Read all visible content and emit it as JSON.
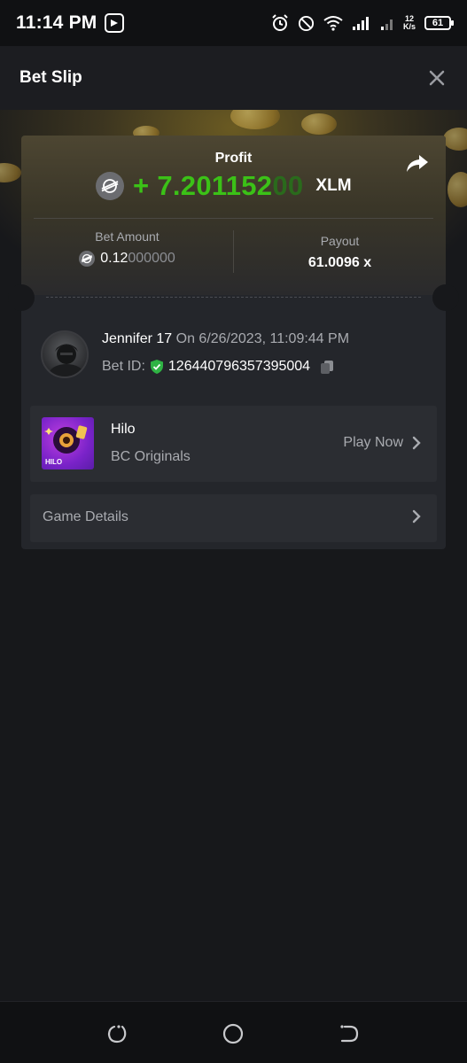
{
  "status_bar": {
    "time": "11:14 PM",
    "net_speed_value": "12",
    "net_speed_unit": "K/s",
    "battery": "61",
    "icons": [
      "alarm-icon",
      "dnd-icon",
      "wifi-icon",
      "signal-icon",
      "signal-icon-2",
      "battery-icon"
    ]
  },
  "header": {
    "title": "Bet Slip",
    "close_icon": "close-icon"
  },
  "slip": {
    "profit_label": "Profit",
    "profit_sign": "+",
    "profit_main": "7.201152",
    "profit_trailing": "00",
    "profit_currency": "XLM",
    "bet_amount_label": "Bet Amount",
    "bet_amount_main": "0.12",
    "bet_amount_trailing": "000000",
    "payout_label": "Payout",
    "payout_value": "61.0096 x",
    "share_icon": "share-icon",
    "coin_icon": "stellar-coin-icon"
  },
  "user": {
    "name": "Jennifer 17",
    "date": "On 6/26/2023, 11:09:44 PM",
    "bet_id_label": "Bet ID:",
    "bet_id": "126440796357395004"
  },
  "game": {
    "name": "Hilo",
    "provider": "BC Originals",
    "thumb_label": "HILO",
    "play_label": "Play Now"
  },
  "details": {
    "label": "Game Details"
  },
  "colors": {
    "profit_green": "#3bc117",
    "background": "#17181b",
    "card": "#24262b",
    "row": "#2b2d32",
    "muted_text": "#a9abb0"
  }
}
